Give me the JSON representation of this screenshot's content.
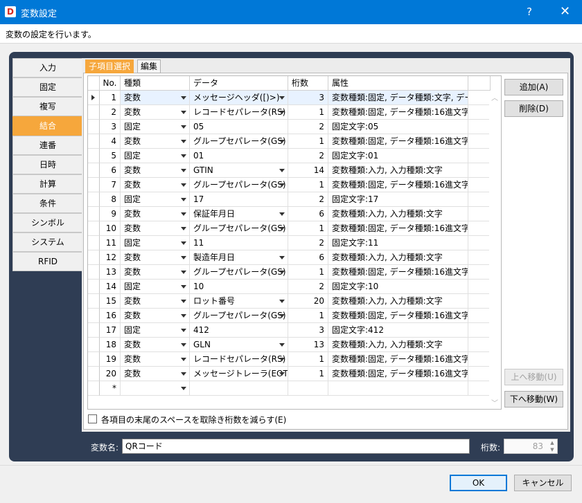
{
  "window": {
    "icon_letter": "D",
    "title": "変数設定",
    "help": "?",
    "close": "✕"
  },
  "description": "変数の設定を行います。",
  "nav": [
    "入力",
    "固定",
    "複写",
    "結合",
    "連番",
    "日時",
    "計算",
    "条件",
    "シンボル",
    "システム",
    "RFID"
  ],
  "nav_selected": "結合",
  "tabs": {
    "active": "子項目選択",
    "inactive": "編集"
  },
  "grid": {
    "headers": {
      "no": "No.",
      "kind": "種類",
      "data": "データ",
      "digits": "桁数",
      "attr": "属性"
    },
    "rows": [
      {
        "no": "1",
        "kind": "変数",
        "data": "メッセージヘッダ([)>)",
        "digits": "3",
        "attr": "変数種類:固定, データ種類:文字, デー..."
      },
      {
        "no": "2",
        "kind": "変数",
        "data": "レコードセパレータ(RS)",
        "digits": "1",
        "attr": "変数種類:固定, データ種類:16進文字..."
      },
      {
        "no": "3",
        "kind": "固定",
        "data": "05",
        "digits": "2",
        "attr": "固定文字:05"
      },
      {
        "no": "4",
        "kind": "変数",
        "data": "グループセパレータ(GS)",
        "digits": "1",
        "attr": "変数種類:固定, データ種類:16進文字..."
      },
      {
        "no": "5",
        "kind": "固定",
        "data": "01",
        "digits": "2",
        "attr": "固定文字:01"
      },
      {
        "no": "6",
        "kind": "変数",
        "data": "GTIN",
        "digits": "14",
        "attr": "変数種類:入力, 入力種類:文字"
      },
      {
        "no": "7",
        "kind": "変数",
        "data": "グループセパレータ(GS)",
        "digits": "1",
        "attr": "変数種類:固定, データ種類:16進文字..."
      },
      {
        "no": "8",
        "kind": "固定",
        "data": "17",
        "digits": "2",
        "attr": "固定文字:17"
      },
      {
        "no": "9",
        "kind": "変数",
        "data": "保証年月日",
        "digits": "6",
        "attr": "変数種類:入力, 入力種類:文字"
      },
      {
        "no": "10",
        "kind": "変数",
        "data": "グループセパレータ(GS)",
        "digits": "1",
        "attr": "変数種類:固定, データ種類:16進文字..."
      },
      {
        "no": "11",
        "kind": "固定",
        "data": "11",
        "digits": "2",
        "attr": "固定文字:11"
      },
      {
        "no": "12",
        "kind": "変数",
        "data": "製造年月日",
        "digits": "6",
        "attr": "変数種類:入力, 入力種類:文字"
      },
      {
        "no": "13",
        "kind": "変数",
        "data": "グループセパレータ(GS)",
        "digits": "1",
        "attr": "変数種類:固定, データ種類:16進文字..."
      },
      {
        "no": "14",
        "kind": "固定",
        "data": "10",
        "digits": "2",
        "attr": "固定文字:10"
      },
      {
        "no": "15",
        "kind": "変数",
        "data": "ロット番号",
        "digits": "20",
        "attr": "変数種類:入力, 入力種類:文字"
      },
      {
        "no": "16",
        "kind": "変数",
        "data": "グループセパレータ(GS)",
        "digits": "1",
        "attr": "変数種類:固定, データ種類:16進文字..."
      },
      {
        "no": "17",
        "kind": "固定",
        "data": "412",
        "digits": "3",
        "attr": "固定文字:412"
      },
      {
        "no": "18",
        "kind": "変数",
        "data": "GLN",
        "digits": "13",
        "attr": "変数種類:入力, 入力種類:文字"
      },
      {
        "no": "19",
        "kind": "変数",
        "data": "レコードセパレータ(RS)",
        "digits": "1",
        "attr": "変数種類:固定, データ種類:16進文字..."
      },
      {
        "no": "20",
        "kind": "変数",
        "data": "メッセージトレーラ(EOT)",
        "digits": "1",
        "attr": "変数種類:固定, データ種類:16進文字..."
      }
    ],
    "new_row_marker": "*"
  },
  "buttons": {
    "add": "追加(A)",
    "delete": "削除(D)",
    "move_up": "上へ移動(U)",
    "move_down": "下へ移動(W)",
    "ok": "OK",
    "cancel": "キャンセル"
  },
  "checkbox_label": "各項目の末尾のスペースを取除き桁数を減らす(E)",
  "var_name": {
    "label": "変数名:",
    "value": "QRコード"
  },
  "digits_field": {
    "label": "桁数:",
    "value": "83"
  }
}
